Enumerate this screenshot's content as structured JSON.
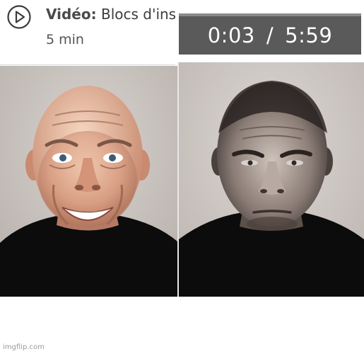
{
  "video_item": {
    "type_label": "Vidéo:",
    "title": "Blocs d'instr",
    "duration": "5 min",
    "play_icon": "play-circle-icon"
  },
  "player": {
    "current_time": "0:03",
    "separator": "/",
    "total_time": "5:59"
  },
  "panels": {
    "left": {
      "expression": "smiling"
    },
    "right": {
      "expression": "serious"
    }
  },
  "watermark": "imgflip.com",
  "colors": {
    "time_bar": "#5a5a5a",
    "dark_clothing": "#0c0c0c",
    "text_gray": "#555555"
  }
}
